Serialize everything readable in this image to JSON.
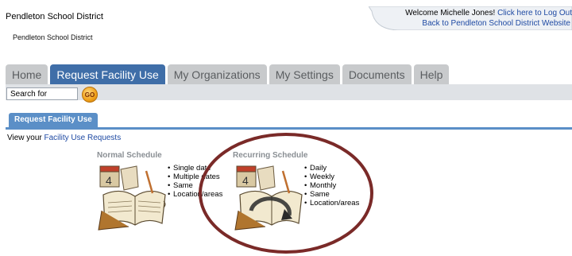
{
  "header": {
    "district_title": "Pendleton School District",
    "district_subtitle": "Pendleton School District",
    "welcome_text": "Welcome Michelle Jones!",
    "logout_link": "Click here to Log Out",
    "back_link": "Back to Pendleton School District Website"
  },
  "tabs": [
    {
      "label": "Home",
      "active": false
    },
    {
      "label": "Request Facility Use",
      "active": true
    },
    {
      "label": "My Organizations",
      "active": false
    },
    {
      "label": "My Settings",
      "active": false
    },
    {
      "label": "Documents",
      "active": false
    },
    {
      "label": "Help",
      "active": false
    }
  ],
  "search": {
    "placeholder": "Search for",
    "go_label": "GO"
  },
  "subtab": {
    "label": "Request Facility Use"
  },
  "view_line": {
    "prefix": "View your",
    "link": "Facility Use Requests"
  },
  "normal_schedule": {
    "title": "Normal Schedule",
    "bullets": [
      "Single date",
      "Multiple dates",
      "Same",
      "Location/areas"
    ]
  },
  "recurring_schedule": {
    "title": "Recurring Schedule",
    "bullets": [
      "Daily",
      "Weekly",
      "Monthly",
      "Same",
      "Location/areas"
    ]
  },
  "colors": {
    "tab_active": "#3f6ea8",
    "link": "#1f4aa3",
    "highlight_circle": "#7a2a28"
  },
  "icons": {
    "calendar": "calendar-book-icon",
    "recurring": "recurring-arrow-icon"
  }
}
